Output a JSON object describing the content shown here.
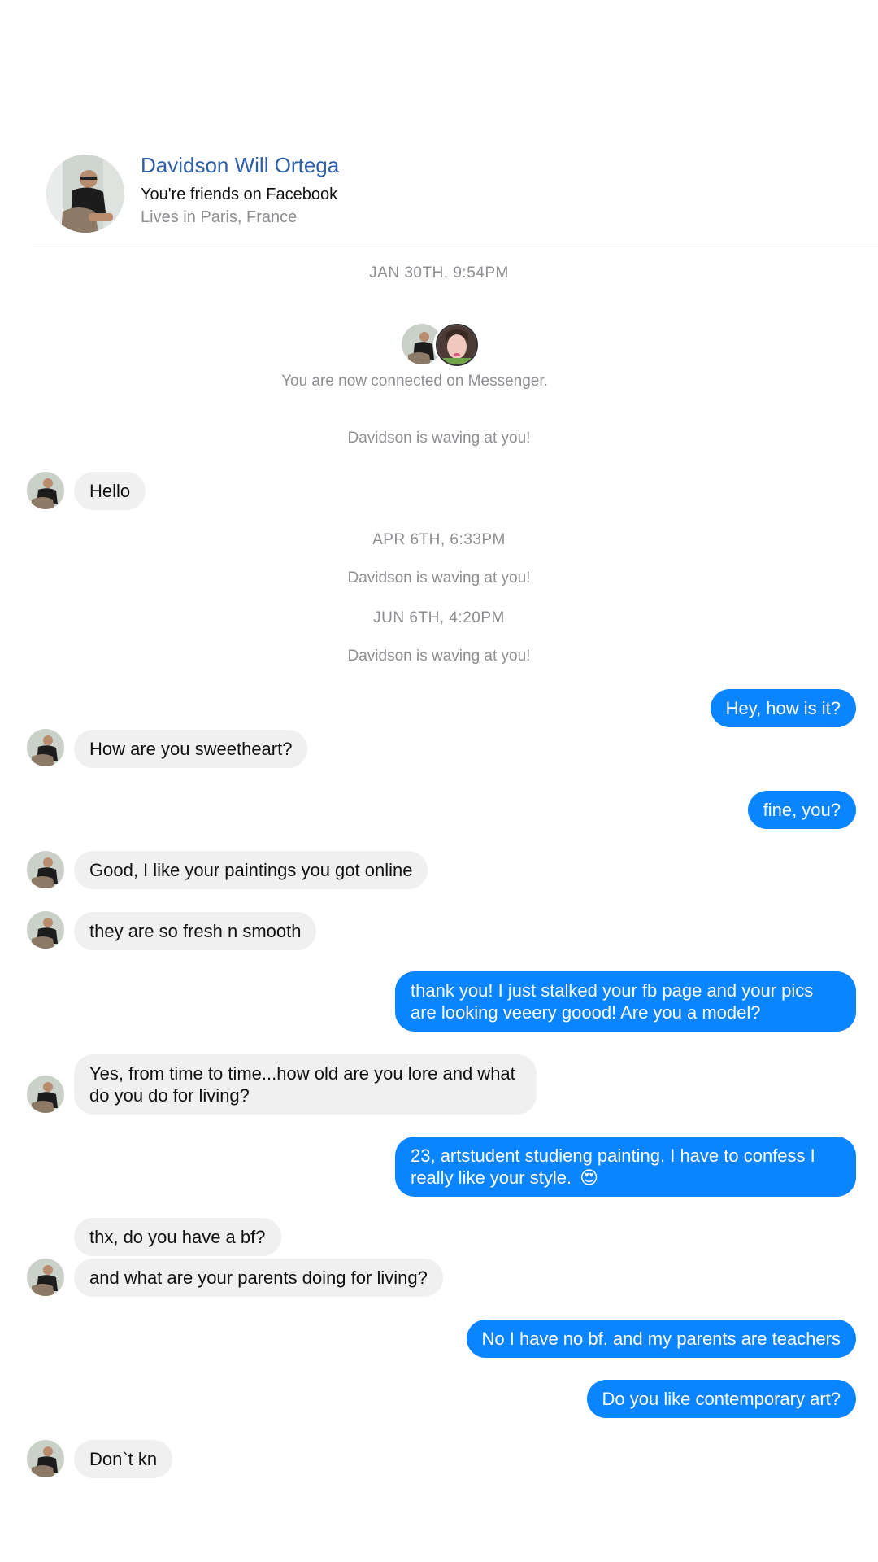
{
  "profile": {
    "name": "Davidson Will Ortega",
    "friends_text": "You're friends on Facebook",
    "location": "Lives in Paris, France"
  },
  "connected_text": "You are now connected on Messenger.",
  "timestamps": [
    "JAN 30TH, 9:54PM",
    "APR 6TH, 6:33PM",
    "JUN 6TH, 4:20PM"
  ],
  "wave_text": "Davidson is waving at you!",
  "messages": [
    {
      "from": "them",
      "text": "Hello"
    },
    {
      "from": "me",
      "text": "Hey, how is it?"
    },
    {
      "from": "them",
      "text": "How are you sweetheart?"
    },
    {
      "from": "me",
      "text": "fine, you?"
    },
    {
      "from": "them",
      "text": "Good, I like your paintings you got online"
    },
    {
      "from": "them",
      "text": "they are so fresh n smooth"
    },
    {
      "from": "me",
      "text": "thank you! I just stalked your fb page and your pics are looking veeery goood! Are you a model?"
    },
    {
      "from": "them",
      "text": "Yes, from time to time...how old are you lore and what do you do for living?"
    },
    {
      "from": "me",
      "text": "23, artstudent studieng painting. I have to confess I really like your style.",
      "emoji": "😍"
    },
    {
      "from": "them",
      "text": "thx, do you have a bf?"
    },
    {
      "from": "them",
      "text": "and what are your parents doing for living?"
    },
    {
      "from": "me",
      "text": "No I have no bf. and my parents are teachers"
    },
    {
      "from": "me",
      "text": "Do you like contemporary art?"
    },
    {
      "from": "them",
      "text": "Don`t kn"
    }
  ],
  "colors": {
    "outgoing_bubble": "#0b84ff",
    "incoming_bubble": "#f0f0f0",
    "profile_name": "#2f5fa9",
    "meta_text": "#8e8e93"
  }
}
